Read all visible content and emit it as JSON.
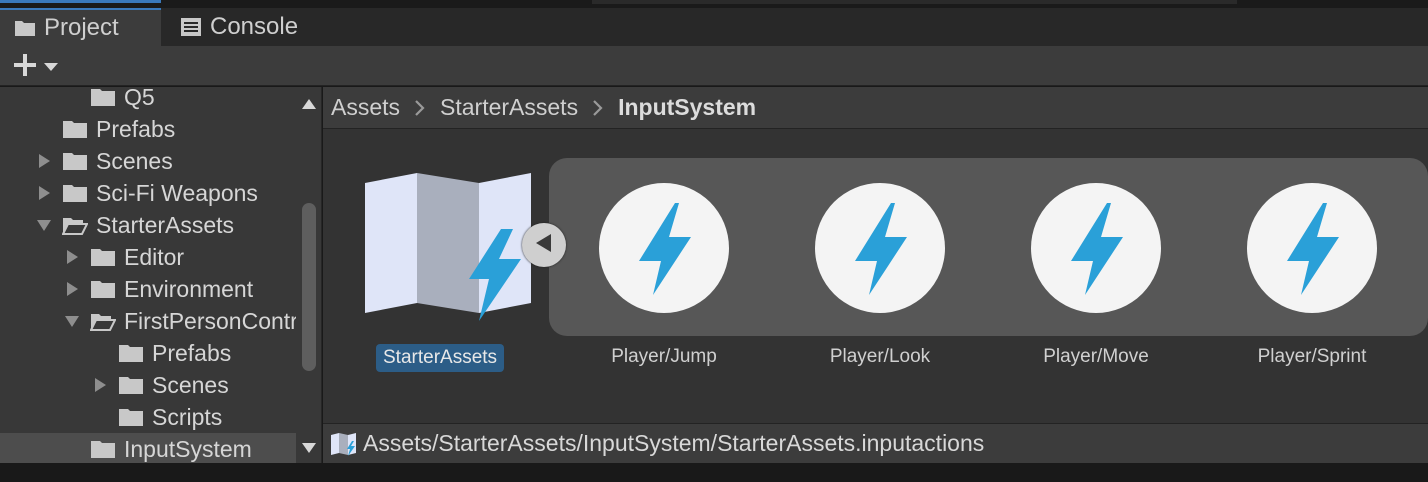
{
  "tabs": [
    {
      "label": "Project",
      "icon": "folder-icon",
      "active": true
    },
    {
      "label": "Console",
      "icon": "console-icon",
      "active": false
    }
  ],
  "toolbar": {
    "create_icon": "plus-icon"
  },
  "tree": {
    "items": [
      {
        "label": "Q5",
        "depth": 3,
        "arrow": "none"
      },
      {
        "label": "Prefabs",
        "depth": 2,
        "arrow": "none"
      },
      {
        "label": "Scenes",
        "depth": 2,
        "arrow": "collapsed"
      },
      {
        "label": "Sci-Fi Weapons",
        "depth": 2,
        "arrow": "collapsed"
      },
      {
        "label": "StarterAssets",
        "depth": 2,
        "arrow": "expanded"
      },
      {
        "label": "Editor",
        "depth": 3,
        "arrow": "collapsed"
      },
      {
        "label": "Environment",
        "depth": 3,
        "arrow": "collapsed"
      },
      {
        "label": "FirstPersonController",
        "depth": 3,
        "arrow": "expanded"
      },
      {
        "label": "Prefabs",
        "depth": 4,
        "arrow": "none"
      },
      {
        "label": "Scenes",
        "depth": 4,
        "arrow": "collapsed"
      },
      {
        "label": "Scripts",
        "depth": 4,
        "arrow": "none"
      },
      {
        "label": "InputSystem",
        "depth": 3,
        "arrow": "none",
        "selected": true
      }
    ]
  },
  "breadcrumb": [
    "Assets",
    "StarterAssets",
    "InputSystem"
  ],
  "main_asset": {
    "label": "StarterAssets",
    "icon": "input-actions-map-icon"
  },
  "sub_assets": [
    {
      "label": "Player/Jump",
      "icon": "lightning-icon"
    },
    {
      "label": "Player/Look",
      "icon": "lightning-icon"
    },
    {
      "label": "Player/Move",
      "icon": "lightning-icon"
    },
    {
      "label": "Player/Sprint",
      "icon": "lightning-icon"
    }
  ],
  "path_bar": {
    "path": "Assets/StarterAssets/InputSystem/StarterAssets.inputactions",
    "icon": "input-actions-map-icon"
  },
  "colors": {
    "accent": "#3a79bb",
    "selection": "#2c5d87",
    "lightning": "#2aa0d8"
  }
}
